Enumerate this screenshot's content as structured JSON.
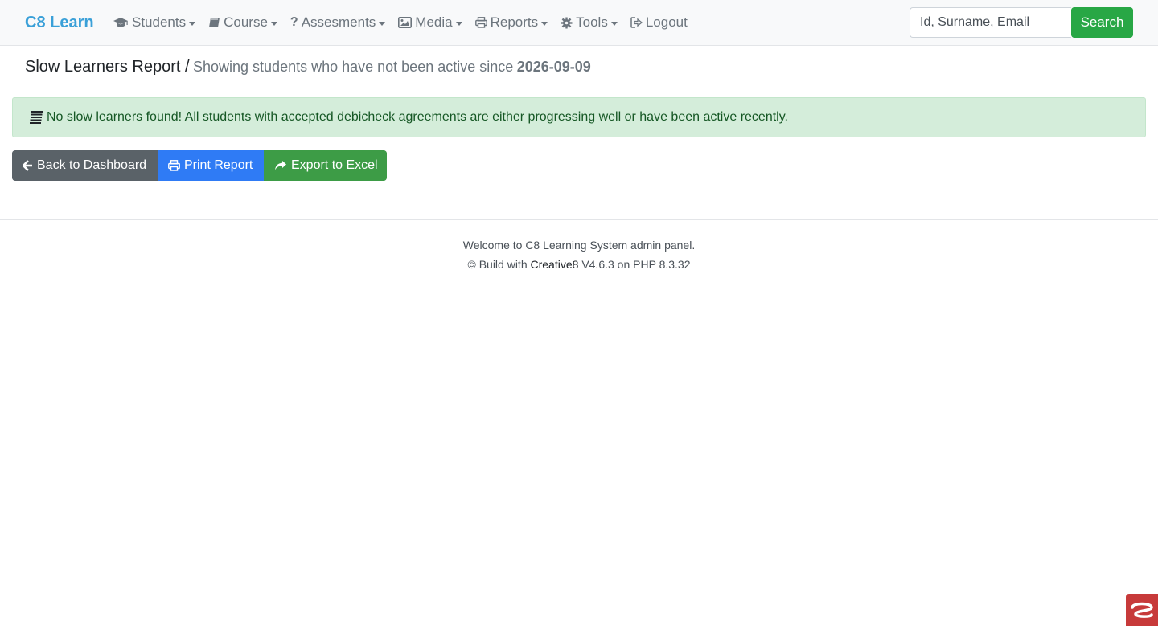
{
  "navbar": {
    "brand": "C8 Learn",
    "items": [
      {
        "label": "Students",
        "icon": "graduation-cap-icon",
        "dropdown": true
      },
      {
        "label": "Course",
        "icon": "book-icon",
        "dropdown": true
      },
      {
        "label": "Assesments",
        "icon": "question-icon",
        "dropdown": true
      },
      {
        "label": "Media",
        "icon": "image-icon",
        "dropdown": true
      },
      {
        "label": "Reports",
        "icon": "printer-icon",
        "dropdown": true
      },
      {
        "label": "Tools",
        "icon": "gear-icon",
        "dropdown": true
      },
      {
        "label": "Logout",
        "icon": "logout-icon",
        "dropdown": false
      }
    ],
    "search": {
      "placeholder": "Id, Surname, Email",
      "button": "Search"
    }
  },
  "heading": {
    "title": "Slow Learners Report /",
    "subtitle": "Showing students who have not been active since",
    "date": "2026-09-09"
  },
  "alert": {
    "icon": "list-icon",
    "text": "No slow learners found! All students with accepted debicheck agreements are either progressing well or have been active recently."
  },
  "actions": {
    "back": "Back to Dashboard",
    "print": "Print Report",
    "export": "Export to Excel"
  },
  "footer": {
    "line1": "Welcome to C8 Learning System admin panel.",
    "line2_prefix": "© Build with",
    "brand": "Creative8",
    "line2_suffix": "V4.6.3 on PHP 8.3.32"
  },
  "colors": {
    "brand": "#3aa0d8",
    "success": "#28a745",
    "primary": "#2f7bf5",
    "secondary": "#5a6268",
    "alert_bg": "#d4edda"
  }
}
